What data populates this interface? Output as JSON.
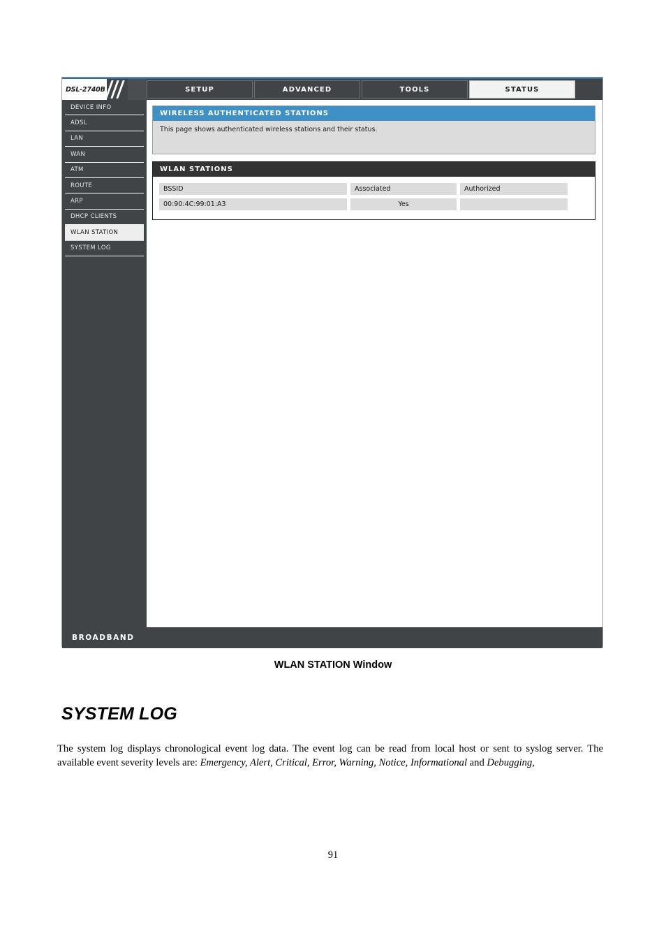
{
  "document": {
    "figure_caption": "WLAN STATION Window",
    "section_heading": "SYSTEM LOG",
    "paragraph_part1": "The system log displays chronological event log data. The event log can be read from local host or sent to syslog server. The available event severity levels are: ",
    "severity_levels": "Emergency, Alert, Critical, Error, Warning, Notice, Informational",
    "paragraph_part2": " and ",
    "severity_last": "Debugging,",
    "page_number": "91"
  },
  "router_ui": {
    "logo": {
      "model": "DSL-2740B"
    },
    "tabs": [
      {
        "label": "SETUP",
        "active": false
      },
      {
        "label": "ADVANCED",
        "active": false
      },
      {
        "label": "TOOLS",
        "active": false
      },
      {
        "label": "STATUS",
        "active": true
      }
    ],
    "sidebar": {
      "items": [
        {
          "label": "DEVICE INFO",
          "active": false
        },
        {
          "label": "ADSL",
          "active": false
        },
        {
          "label": "LAN",
          "active": false
        },
        {
          "label": "WAN",
          "active": false
        },
        {
          "label": "ATM",
          "active": false
        },
        {
          "label": "ROUTE",
          "active": false
        },
        {
          "label": "ARP",
          "active": false
        },
        {
          "label": "DHCP CLIENTS",
          "active": false
        },
        {
          "label": "WLAN STATION",
          "active": true
        },
        {
          "label": "SYSTEM LOG",
          "active": false
        }
      ]
    },
    "info_panel": {
      "title": "WIRELESS AUTHENTICATED STATIONS",
      "description": "This page shows authenticated wireless stations and their status."
    },
    "stations_panel": {
      "title": "WLAN STATIONS",
      "columns": [
        "BSSID",
        "Associated",
        "Authorized"
      ],
      "rows": [
        {
          "bssid": "00:90:4C:99:01:A3",
          "associated": "Yes",
          "authorized": ""
        }
      ]
    },
    "footer": {
      "label": "BROADBAND"
    },
    "colors": {
      "accent_blue": "#3f90c4",
      "dark_panel": "#333333",
      "chrome_dark": "#404446",
      "field_gray": "#dcdcdc",
      "active_tab": "#f2f2f2"
    }
  }
}
